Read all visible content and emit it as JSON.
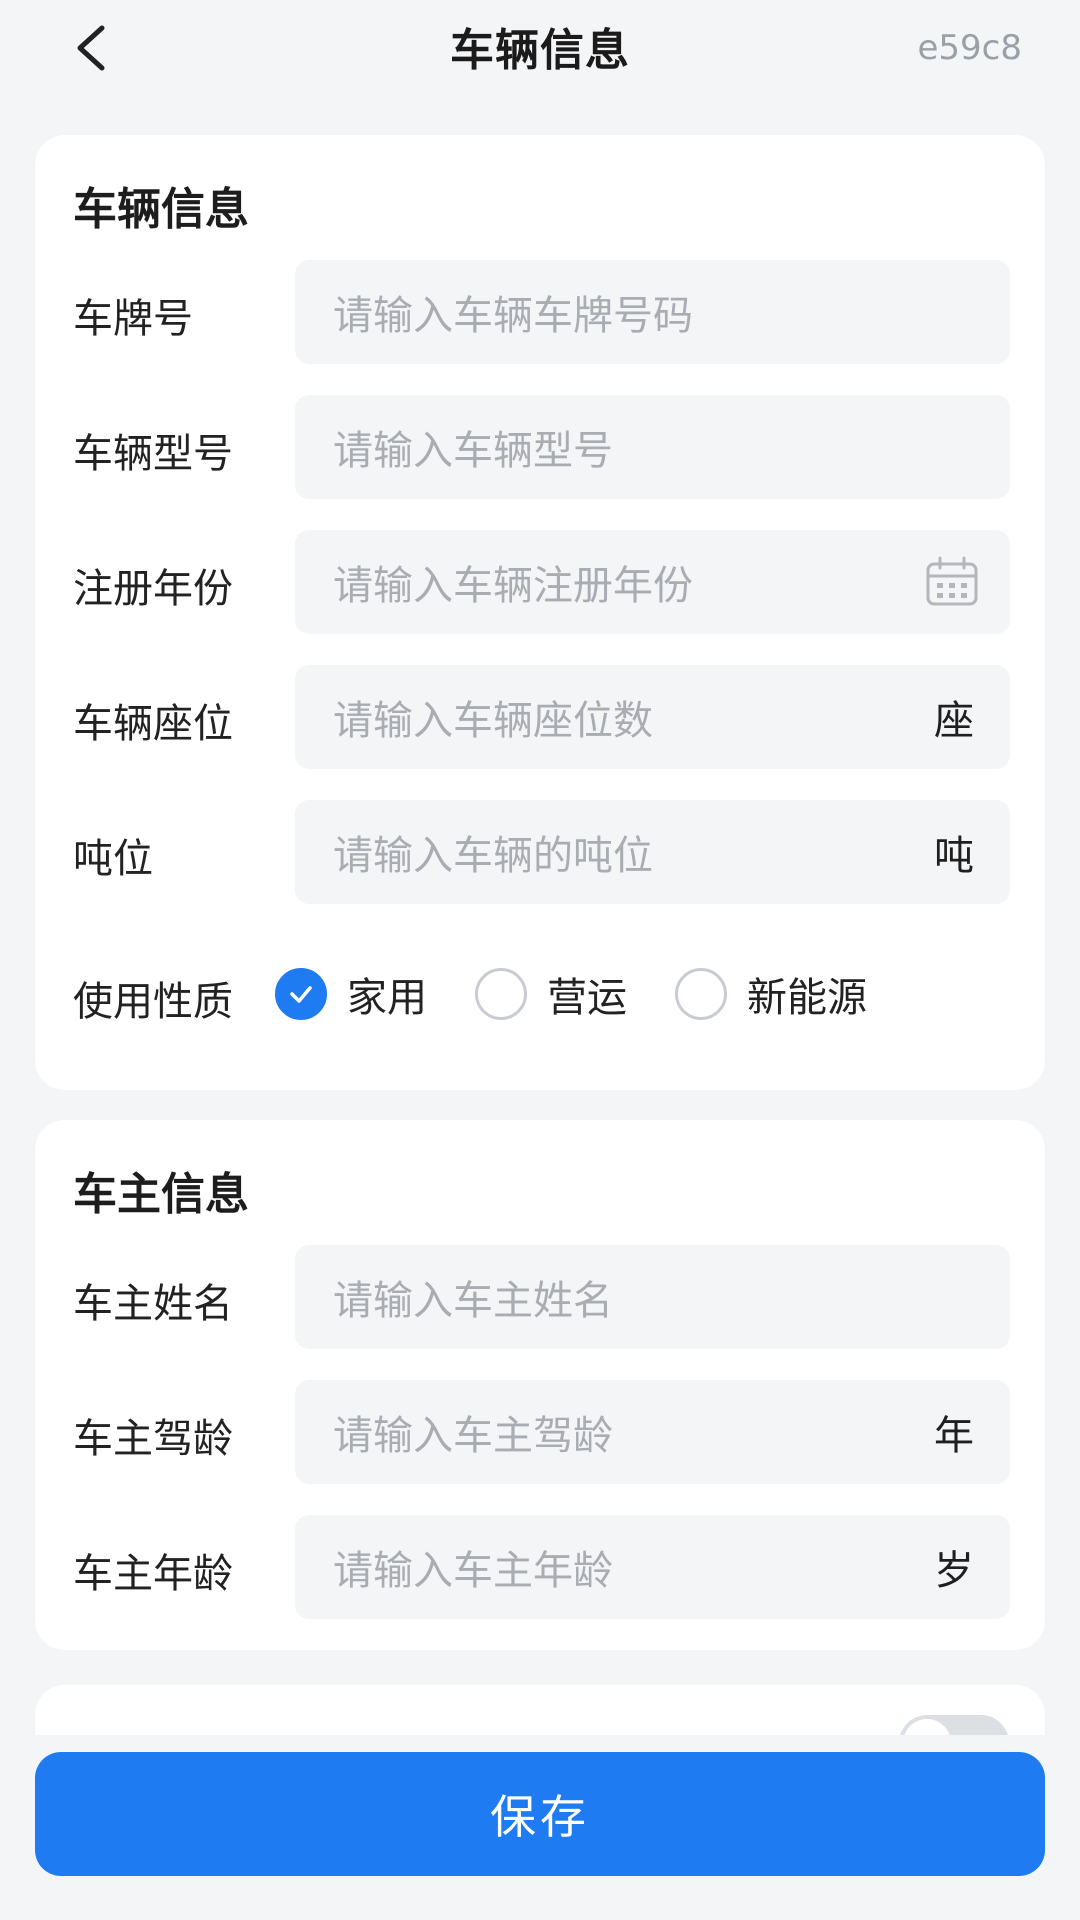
{
  "header": {
    "title": "车辆信息",
    "corner_id": "e59c8"
  },
  "vehicle": {
    "section_title": "车辆信息",
    "plate": {
      "label": "车牌号",
      "placeholder": "请输入车辆车牌号码"
    },
    "model": {
      "label": "车辆型号",
      "placeholder": "请输入车辆型号"
    },
    "reg_year": {
      "label": "注册年份",
      "placeholder": "请输入车辆注册年份"
    },
    "seats": {
      "label": "车辆座位",
      "placeholder": "请输入车辆座位数",
      "unit": "座"
    },
    "tonnage": {
      "label": "吨位",
      "placeholder": "请输入车辆的吨位",
      "unit": "吨"
    },
    "usage": {
      "label": "使用性质",
      "options": [
        "家用",
        "营运",
        "新能源"
      ],
      "selected": "家用"
    }
  },
  "owner": {
    "section_title": "车主信息",
    "name": {
      "label": "车主姓名",
      "placeholder": "请输入车主姓名"
    },
    "driving_age": {
      "label": "车主驾龄",
      "placeholder": "请输入车主驾龄",
      "unit": "年"
    },
    "age": {
      "label": "车主年龄",
      "placeholder": "请输入车主年龄",
      "unit": "岁"
    }
  },
  "actions": {
    "save_label": "保存"
  },
  "colors": {
    "primary": "#1e7bf2",
    "background": "#f4f5f7",
    "placeholder": "#a9adb3"
  },
  "icons": {
    "back": "chevron-left-icon",
    "calendar": "calendar-icon",
    "check": "check-icon"
  }
}
